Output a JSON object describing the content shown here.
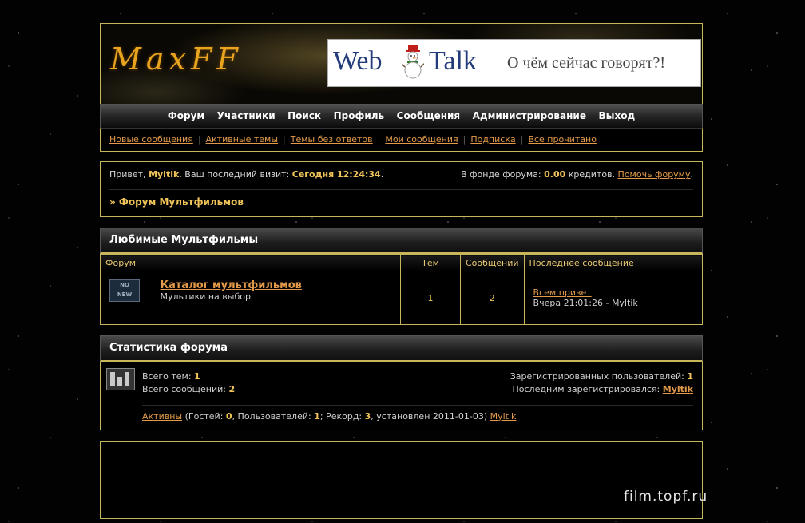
{
  "header": {
    "logo_text": "MaxFF",
    "banner": {
      "web": "Web",
      "talk": "Talk",
      "slogan": "О чём сейчас говорят?!"
    }
  },
  "nav": [
    "Форум",
    "Участники",
    "Поиск",
    "Профиль",
    "Сообщения",
    "Администрирование",
    "Выход"
  ],
  "subnav": [
    "Новые сообщения",
    "Активные темы",
    "Темы без ответов",
    "Мои сообщения",
    "Подписка",
    "Все прочитано"
  ],
  "welcome": {
    "greeting": "Привет, ",
    "user": "Myltik",
    "last_visit_label": ".  Ваш последний визит: ",
    "last_visit": "Сегодня 12:24:34",
    "fund_label": "В фонде форума: ",
    "fund_amount": "0.00",
    "fund_unit": " кредитов. ",
    "help_link": "Помочь форуму",
    "breadcrumb": "» Форум Мультфильмов"
  },
  "category": {
    "title": "Любимые Мультфильмы",
    "headers": {
      "forum": "Форум",
      "topics": "Тем",
      "posts": "Сообщений",
      "last": "Последнее сообщение"
    },
    "forums": [
      {
        "icon_top": "NO",
        "icon_bottom": "NEW",
        "name": "Каталог мультфильмов",
        "desc": "Мультики на выбор",
        "topics": "1",
        "posts": "2",
        "last_title": "Всем привет",
        "last_meta": "Вчера 21:01:26 - Myltik"
      }
    ]
  },
  "stats": {
    "title": "Статистика форума",
    "total_topics_label": "Всего тем: ",
    "total_topics": "1",
    "total_posts_label": "Всего сообщений: ",
    "total_posts": "2",
    "registered_label": "Зарегистрированных пользователей: ",
    "registered": "1",
    "last_registered_label": "Последним зарегистрировался: ",
    "last_registered": "Myltik",
    "online_link": "Активны",
    "online_text_1": " (Гостей: ",
    "guests": "0",
    "online_text_2": ", Пользователей: ",
    "users": "1",
    "online_text_3": "; Рекорд: ",
    "record": "3",
    "online_text_4": ", установлен 2011-01-03) ",
    "online_user": "Myltik"
  },
  "watermark": "film.topf.ru",
  "colors": {
    "accent": "#f0c45a",
    "link": "#e29a4a",
    "border": "#c8b65a"
  }
}
